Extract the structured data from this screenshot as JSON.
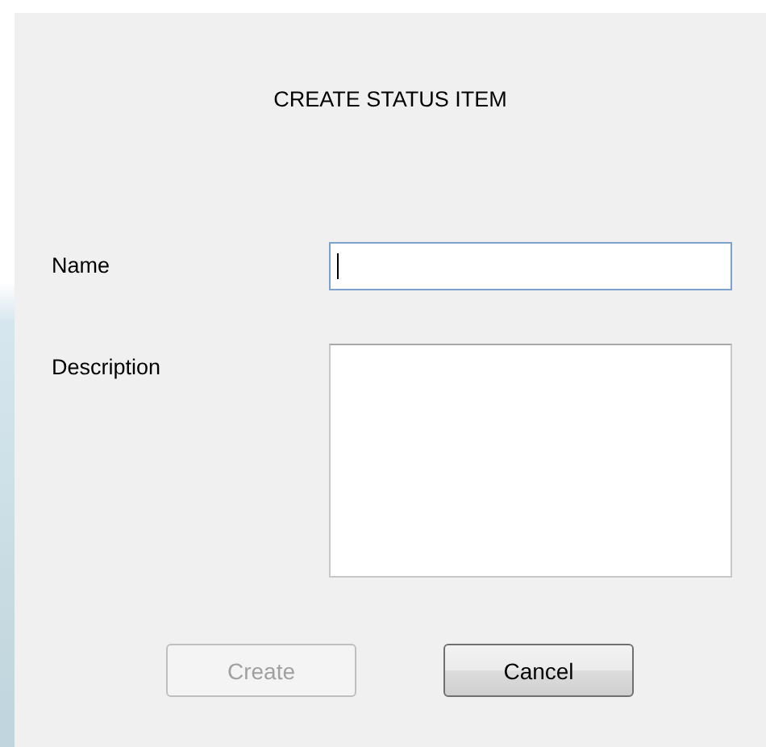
{
  "dialog": {
    "title": "CREATE STATUS ITEM"
  },
  "fields": [
    {
      "label": "Name",
      "kind": "text",
      "focused": true
    },
    {
      "label": "Description",
      "kind": "multiline",
      "focused": false
    }
  ],
  "buttons": [
    {
      "label": "Create",
      "disabled": true
    },
    {
      "label": "Cancel",
      "disabled": false
    }
  ]
}
